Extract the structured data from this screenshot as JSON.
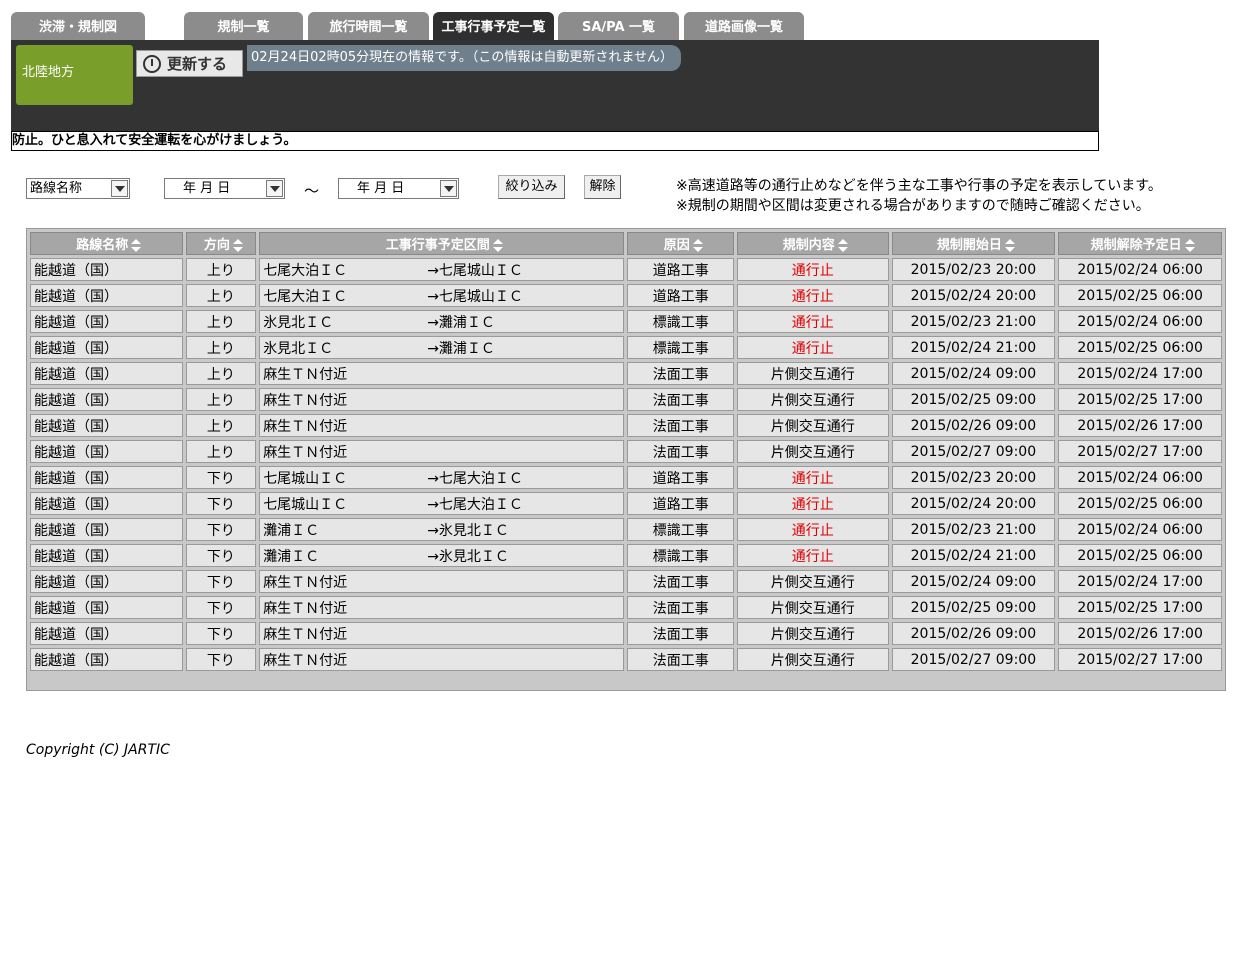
{
  "tabs": [
    {
      "label": "渋滞・規制図",
      "active": false
    },
    {
      "label": "規制一覧",
      "active": false
    },
    {
      "label": "旅行時間一覧",
      "active": false
    },
    {
      "label": "工事行事予定一覧",
      "active": true
    },
    {
      "label": "SA/PA 一覧",
      "active": false
    },
    {
      "label": "道路画像一覧",
      "active": false
    }
  ],
  "header": {
    "region": "北陸地方",
    "refresh_label": "更新する",
    "status": "02月24日02時05分現在の情報です。（この情報は自動更新されません）",
    "marquee": "防止。ひと息入れて安全運転を心がけましょう。"
  },
  "filters": {
    "route_select": "路線名称",
    "date_from": "年 月 日",
    "tilde": "～",
    "date_to": "年 月 日",
    "filter_label": "絞り込み",
    "clear_label": "解除",
    "notes": [
      "※高速道路等の通行止めなどを伴う主な工事や行事の予定を表示しています。",
      "※規制の期間や区間は変更される場合がありますので随時ご確認ください。"
    ]
  },
  "table": {
    "headers": [
      "路線名称",
      "方向",
      "工事行事予定区間",
      "原因",
      "規制内容",
      "規制開始日",
      "規制解除予定日"
    ],
    "rows": [
      {
        "route": "能越道（国）",
        "dir": "上り",
        "from": "七尾大泊ＩＣ",
        "to": "→七尾城山ＩＣ",
        "cause": "道路工事",
        "content": "通行止",
        "red": true,
        "start": "2015/02/23 20:00",
        "end": "2015/02/24 06:00"
      },
      {
        "route": "能越道（国）",
        "dir": "上り",
        "from": "七尾大泊ＩＣ",
        "to": "→七尾城山ＩＣ",
        "cause": "道路工事",
        "content": "通行止",
        "red": true,
        "start": "2015/02/24 20:00",
        "end": "2015/02/25 06:00"
      },
      {
        "route": "能越道（国）",
        "dir": "上り",
        "from": "氷見北ＩＣ",
        "to": "→灘浦ＩＣ",
        "cause": "標識工事",
        "content": "通行止",
        "red": true,
        "start": "2015/02/23 21:00",
        "end": "2015/02/24 06:00"
      },
      {
        "route": "能越道（国）",
        "dir": "上り",
        "from": "氷見北ＩＣ",
        "to": "→灘浦ＩＣ",
        "cause": "標識工事",
        "content": "通行止",
        "red": true,
        "start": "2015/02/24 21:00",
        "end": "2015/02/25 06:00"
      },
      {
        "route": "能越道（国）",
        "dir": "上り",
        "from": "麻生ＴＮ付近",
        "to": "",
        "cause": "法面工事",
        "content": "片側交互通行",
        "red": false,
        "start": "2015/02/24 09:00",
        "end": "2015/02/24 17:00"
      },
      {
        "route": "能越道（国）",
        "dir": "上り",
        "from": "麻生ＴＮ付近",
        "to": "",
        "cause": "法面工事",
        "content": "片側交互通行",
        "red": false,
        "start": "2015/02/25 09:00",
        "end": "2015/02/25 17:00"
      },
      {
        "route": "能越道（国）",
        "dir": "上り",
        "from": "麻生ＴＮ付近",
        "to": "",
        "cause": "法面工事",
        "content": "片側交互通行",
        "red": false,
        "start": "2015/02/26 09:00",
        "end": "2015/02/26 17:00"
      },
      {
        "route": "能越道（国）",
        "dir": "上り",
        "from": "麻生ＴＮ付近",
        "to": "",
        "cause": "法面工事",
        "content": "片側交互通行",
        "red": false,
        "start": "2015/02/27 09:00",
        "end": "2015/02/27 17:00"
      },
      {
        "route": "能越道（国）",
        "dir": "下り",
        "from": "七尾城山ＩＣ",
        "to": "→七尾大泊ＩＣ",
        "cause": "道路工事",
        "content": "通行止",
        "red": true,
        "start": "2015/02/23 20:00",
        "end": "2015/02/24 06:00"
      },
      {
        "route": "能越道（国）",
        "dir": "下り",
        "from": "七尾城山ＩＣ",
        "to": "→七尾大泊ＩＣ",
        "cause": "道路工事",
        "content": "通行止",
        "red": true,
        "start": "2015/02/24 20:00",
        "end": "2015/02/25 06:00"
      },
      {
        "route": "能越道（国）",
        "dir": "下り",
        "from": "灘浦ＩＣ",
        "to": "→氷見北ＩＣ",
        "cause": "標識工事",
        "content": "通行止",
        "red": true,
        "start": "2015/02/23 21:00",
        "end": "2015/02/24 06:00"
      },
      {
        "route": "能越道（国）",
        "dir": "下り",
        "from": "灘浦ＩＣ",
        "to": "→氷見北ＩＣ",
        "cause": "標識工事",
        "content": "通行止",
        "red": true,
        "start": "2015/02/24 21:00",
        "end": "2015/02/25 06:00"
      },
      {
        "route": "能越道（国）",
        "dir": "下り",
        "from": "麻生ＴＮ付近",
        "to": "",
        "cause": "法面工事",
        "content": "片側交互通行",
        "red": false,
        "start": "2015/02/24 09:00",
        "end": "2015/02/24 17:00"
      },
      {
        "route": "能越道（国）",
        "dir": "下り",
        "from": "麻生ＴＮ付近",
        "to": "",
        "cause": "法面工事",
        "content": "片側交互通行",
        "red": false,
        "start": "2015/02/25 09:00",
        "end": "2015/02/25 17:00"
      },
      {
        "route": "能越道（国）",
        "dir": "下り",
        "from": "麻生ＴＮ付近",
        "to": "",
        "cause": "法面工事",
        "content": "片側交互通行",
        "red": false,
        "start": "2015/02/26 09:00",
        "end": "2015/02/26 17:00"
      },
      {
        "route": "能越道（国）",
        "dir": "下り",
        "from": "麻生ＴＮ付近",
        "to": "",
        "cause": "法面工事",
        "content": "片側交互通行",
        "red": false,
        "start": "2015/02/27 09:00",
        "end": "2015/02/27 17:00"
      }
    ]
  },
  "footer": {
    "copyright": "Copyright (C) JARTIC"
  },
  "colors": {
    "region": "#7a9e2a",
    "band": "#333333",
    "status": "#6f7f8c",
    "alert": "#e00000",
    "header_cell": "#a6a6a6"
  }
}
